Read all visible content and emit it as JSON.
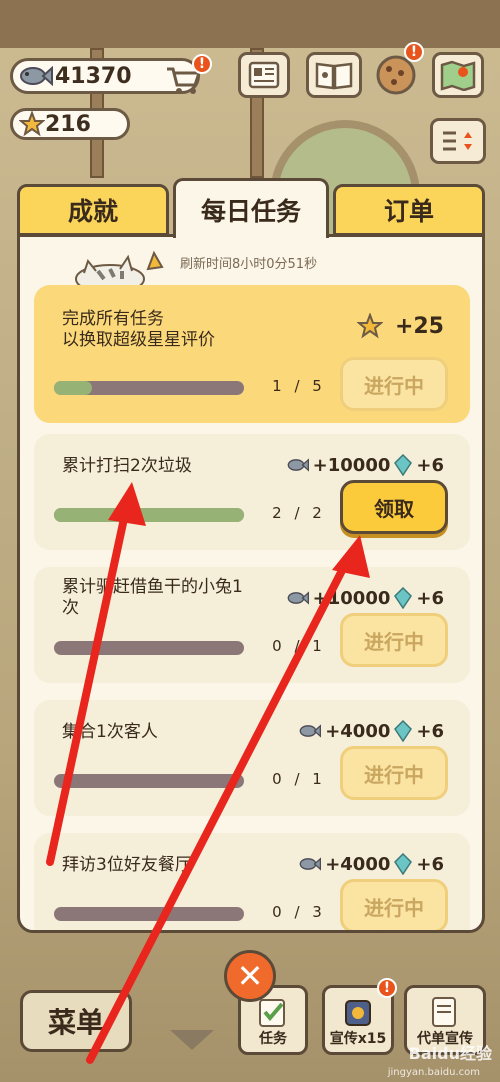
{
  "resources": {
    "fish": "41370",
    "stars": "216"
  },
  "tabs": [
    {
      "label": "成就"
    },
    {
      "label": "每日任务"
    },
    {
      "label": "订单"
    }
  ],
  "refresh_text": "刷新时间8小时0分51秒",
  "tasks": [
    {
      "title_line1": "完成所有任务",
      "title_line2": "以换取超级星星评价",
      "reward": "+25",
      "progress": 0.2,
      "count": "1 / 5",
      "button": "进行中"
    },
    {
      "title": "累计打扫2次垃圾",
      "fish_reward": "+10000",
      "gem_reward": "+6",
      "progress": 1.0,
      "count": "2 / 2",
      "button": "领取"
    },
    {
      "title_line1": "累计驱赶借鱼干的小兔1",
      "title_line2": "次",
      "fish_reward": "+10000",
      "gem_reward": "+6",
      "progress": 0.0,
      "count": "0 / 1",
      "button": "进行中"
    },
    {
      "title": "集合1次客人",
      "fish_reward": "+4000",
      "gem_reward": "+6",
      "progress": 0.0,
      "count": "0 / 1",
      "button": "进行中"
    },
    {
      "title": "拜访3位好友餐厅",
      "fish_reward": "+4000",
      "gem_reward": "+6",
      "progress": 0.0,
      "count": "0 / 3",
      "button": "进行中"
    }
  ],
  "bottom": {
    "menu": "菜单",
    "close": "✕",
    "tasks_label": "任务",
    "promo_label": "宣传x15",
    "other_label": "代单宣传"
  },
  "watermark": {
    "main": "Baidu经验",
    "sub": "jingyan.baidu.com"
  },
  "colors": {
    "accent": "#fbd45a",
    "panel": "#fbf6e8",
    "progress_fill": "#96b274",
    "arrow": "#e8261d"
  }
}
